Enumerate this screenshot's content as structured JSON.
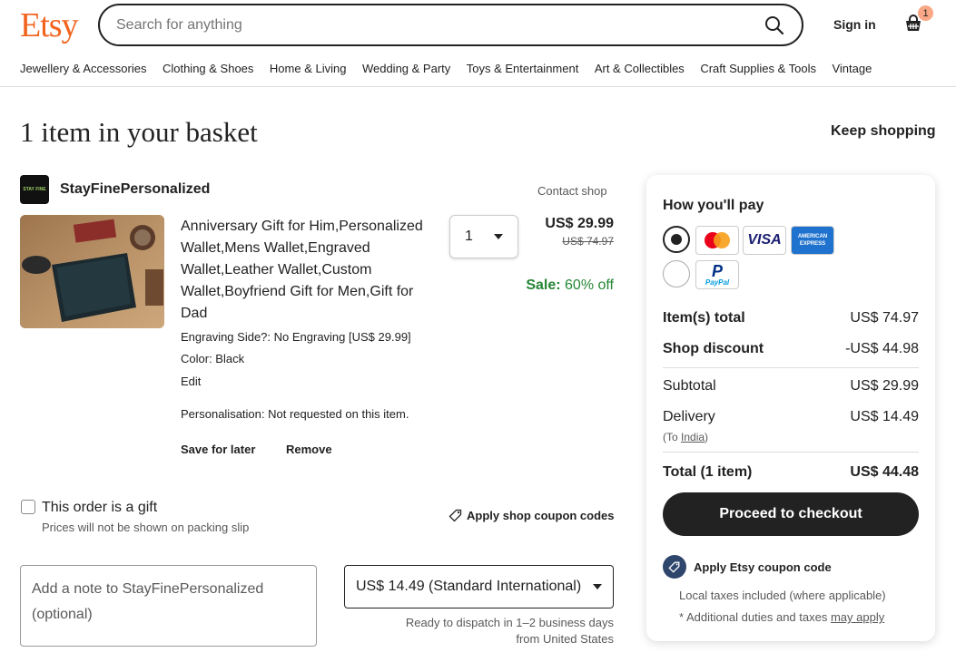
{
  "header": {
    "logo": "Etsy",
    "search_placeholder": "Search for anything",
    "sign_in": "Sign in",
    "basket_count": "1"
  },
  "nav": [
    "Jewellery & Accessories",
    "Clothing & Shoes",
    "Home & Living",
    "Wedding & Party",
    "Toys & Entertainment",
    "Art & Collectibles",
    "Craft Supplies & Tools",
    "Vintage"
  ],
  "page": {
    "title": "1 item in your basket",
    "keep_shopping": "Keep shopping"
  },
  "shop": {
    "logo_text": "STAY FINE",
    "name": "StayFinePersonalized",
    "contact": "Contact shop"
  },
  "item": {
    "title": "Anniversary Gift for Him,Personalized Wallet,Mens Wallet,Engraved Wallet,Leather Wallet,Custom Wallet,Boyfriend Gift for Men,Gift for Dad",
    "engraving": "Engraving Side?: No Engraving [US$ 29.99]",
    "color": "Color: Black",
    "edit": "Edit",
    "personalisation": "Personalisation: Not requested on this item.",
    "save_for_later": "Save for later",
    "remove": "Remove",
    "quantity": "1",
    "price": "US$ 29.99",
    "original_price": "US$ 74.97",
    "sale_label": "Sale:",
    "sale_value": "60% off"
  },
  "gift": {
    "label": "This order is a gift",
    "sub": "Prices will not be shown on packing slip"
  },
  "shop_coupon": "Apply shop coupon codes",
  "note_placeholder": "Add a note to StayFinePersonalized (optional)",
  "delivery": {
    "option": "US$ 14.49 (Standard International)",
    "dispatch_line1": "Ready to dispatch in 1–2 business days",
    "dispatch_line2": "from United States"
  },
  "summary": {
    "how_pay": "How you'll pay",
    "visa": "VISA",
    "amex_line1": "AMERICAN",
    "amex_line2": "EXPRESS",
    "paypal": "PayPal",
    "items_total_label": "Item(s) total",
    "items_total": "US$ 74.97",
    "discount_label": "Shop discount",
    "discount": "-US$ 44.98",
    "subtotal_label": "Subtotal",
    "subtotal": "US$ 29.99",
    "delivery_label": "Delivery",
    "delivery": "US$ 14.49",
    "to_prefix": "(To ",
    "country": "India",
    "to_suffix": ")",
    "total_label": "Total (1 item)",
    "total": "US$ 44.48",
    "checkout": "Proceed to checkout",
    "etsy_coupon": "Apply Etsy coupon code",
    "tax_note": "Local taxes included (where applicable)",
    "duties_prefix": "* Additional duties and taxes ",
    "duties_link": "may apply"
  }
}
